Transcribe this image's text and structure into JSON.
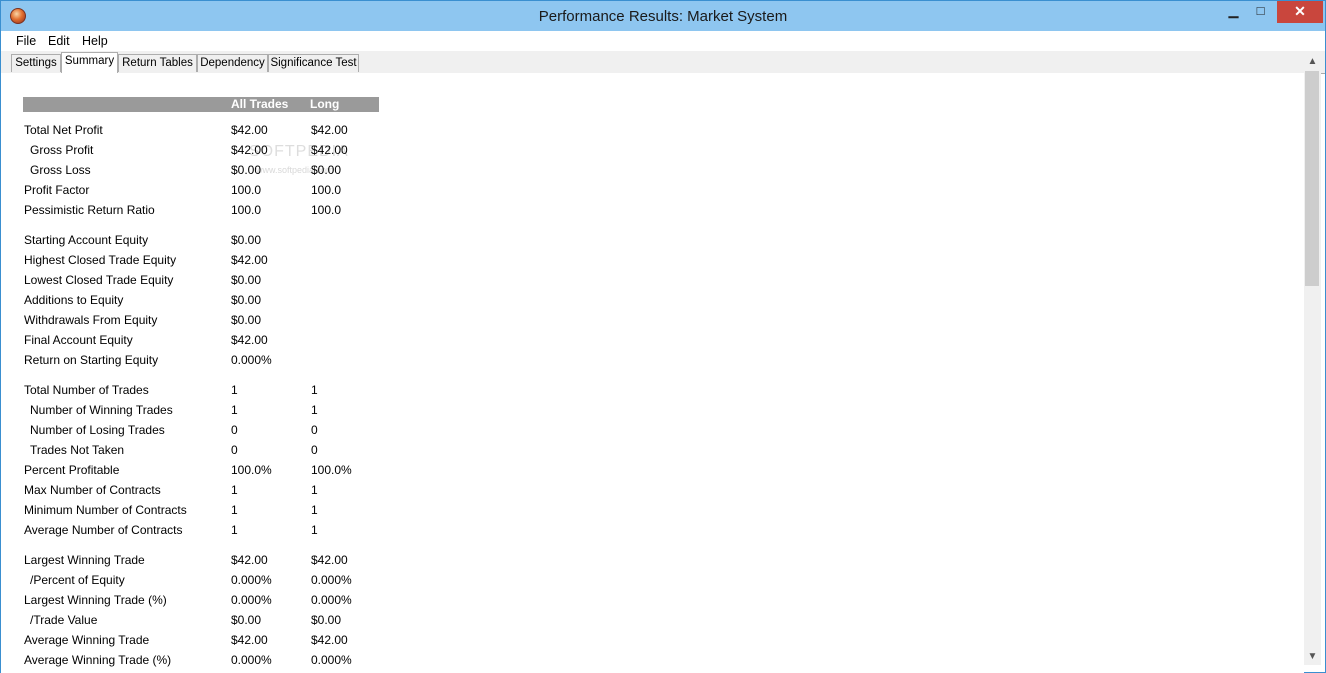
{
  "window": {
    "title": "Performance Results: Market System",
    "minimize": "▁",
    "maximize": "□",
    "close": "✕",
    "icon": "app-logo-icon"
  },
  "menu": [
    "File",
    "Edit",
    "Help"
  ],
  "tabs": [
    "Settings",
    "Summary",
    "Return Tables",
    "Dependency",
    "Significance Test"
  ],
  "active_tab": "Summary",
  "table": {
    "headers": [
      "",
      "All Trades",
      "Long"
    ],
    "rows": [
      {
        "label": "Total Net Profit",
        "all": "$42.00",
        "long": "$42.00"
      },
      {
        "label": "Gross Profit",
        "all": "$42.00",
        "long": "$42.00"
      },
      {
        "label": "Gross Loss",
        "all": "$0.00",
        "long": "$0.00"
      },
      {
        "label": "Profit Factor",
        "all": "100.0",
        "long": "100.0"
      },
      {
        "label": "Pessimistic Return Ratio",
        "all": "100.0",
        "long": "100.0"
      },
      {
        "label": "Starting Account Equity",
        "all": "$0.00",
        "long": ""
      },
      {
        "label": "Highest Closed Trade Equity",
        "all": "$42.00",
        "long": ""
      },
      {
        "label": "Lowest Closed Trade Equity",
        "all": "$0.00",
        "long": ""
      },
      {
        "label": "Additions to Equity",
        "all": "$0.00",
        "long": ""
      },
      {
        "label": "Withdrawals From Equity",
        "all": "$0.00",
        "long": ""
      },
      {
        "label": "Final Account Equity",
        "all": "$42.00",
        "long": ""
      },
      {
        "label": "Return on Starting Equity",
        "all": "0.000%",
        "long": ""
      },
      {
        "label": "Total Number of Trades",
        "all": "1",
        "long": "1"
      },
      {
        "label": "Number of Winning Trades",
        "all": "1",
        "long": "1"
      },
      {
        "label": "Number of Losing Trades",
        "all": "0",
        "long": "0"
      },
      {
        "label": "Trades Not Taken",
        "all": "0",
        "long": "0"
      },
      {
        "label": "Percent Profitable",
        "all": "100.0%",
        "long": "100.0%"
      },
      {
        "label": "Max Number of Contracts",
        "all": "1",
        "long": "1"
      },
      {
        "label": "Minimum Number of Contracts",
        "all": "1",
        "long": "1"
      },
      {
        "label": "Average Number of Contracts",
        "all": "1",
        "long": "1"
      },
      {
        "label": "Largest Winning Trade",
        "all": "$42.00",
        "long": "$42.00"
      },
      {
        "label": "/Percent of Equity",
        "all": "0.000%",
        "long": "0.000%"
      },
      {
        "label": "Largest Winning Trade (%)",
        "all": "0.000%",
        "long": "0.000%"
      },
      {
        "label": "/Trade Value",
        "all": "$0.00",
        "long": "$0.00"
      },
      {
        "label": "Average Winning Trade",
        "all": "$42.00",
        "long": "$42.00"
      },
      {
        "label": "Average Winning Trade (%)",
        "all": "0.000%",
        "long": "0.000%"
      }
    ]
  },
  "watermark": "SOFTPEDIA",
  "watermark_url": "www.softpedia.com"
}
